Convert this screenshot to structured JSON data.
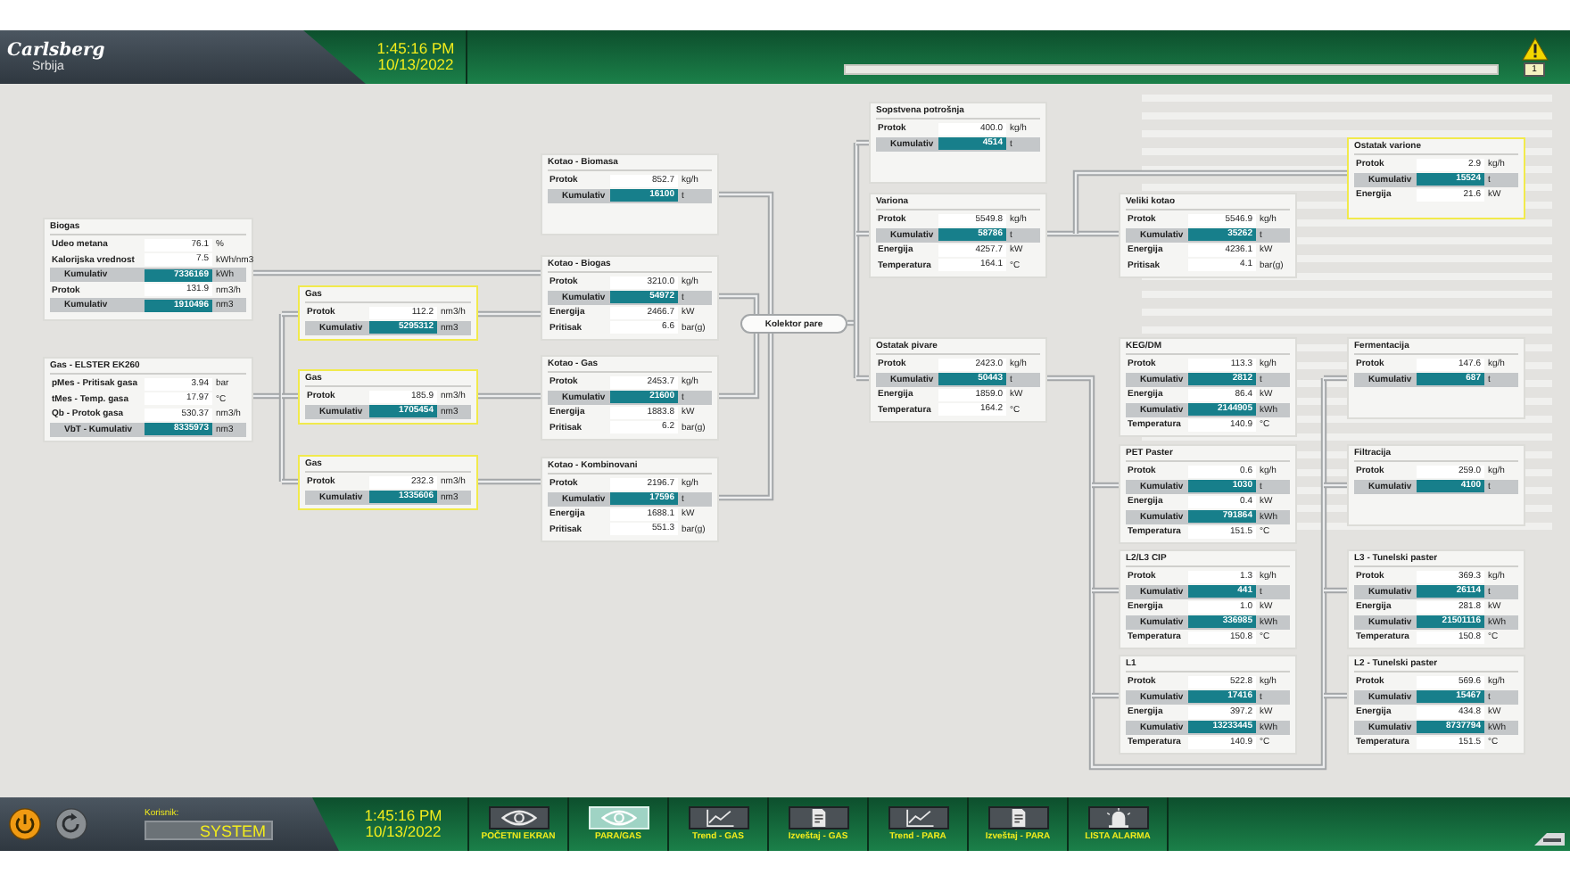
{
  "header": {
    "brand": "Carlsberg",
    "region": "Srbija",
    "time": "1:45:16 PM",
    "date": "10/13/2022",
    "alarm_count": "1"
  },
  "panels": [
    {
      "title": "Biogas",
      "highlighted": false,
      "rows": [
        {
          "kind": "value",
          "label": "Udeo metana",
          "value": "76.1",
          "unit": "%"
        },
        {
          "kind": "value",
          "label": "Kalorijska vrednost",
          "value": "7.5",
          "unit": "kWh/nm3"
        },
        {
          "kind": "total",
          "label": "Kumulativ",
          "value": "7336169",
          "unit": "kWh"
        },
        {
          "kind": "value",
          "label": "Protok",
          "value": "131.9",
          "unit": "nm3/h"
        },
        {
          "kind": "total",
          "label": "Kumulativ",
          "value": "1910496",
          "unit": "nm3"
        }
      ]
    },
    {
      "title": "Gas - ELSTER EK260",
      "highlighted": false,
      "rows": [
        {
          "kind": "value",
          "label": "pMes - Pritisak gasa",
          "value": "3.94",
          "unit": "bar"
        },
        {
          "kind": "value",
          "label": "tMes - Temp. gasa",
          "value": "17.97",
          "unit": "°C"
        },
        {
          "kind": "value",
          "label": "Qb - Protok gasa",
          "value": "530.37",
          "unit": "nm3/h"
        },
        {
          "kind": "total",
          "label": "VbT - Kumulativ",
          "value": "8335973",
          "unit": "nm3"
        }
      ]
    },
    {
      "title": "Gas",
      "highlighted": true,
      "rows": [
        {
          "kind": "value",
          "label": "Protok",
          "value": "112.2",
          "unit": "nm3/h"
        },
        {
          "kind": "total",
          "label": "Kumulativ",
          "value": "5295312",
          "unit": "nm3"
        }
      ]
    },
    {
      "title": "Gas",
      "highlighted": true,
      "rows": [
        {
          "kind": "value",
          "label": "Protok",
          "value": "185.9",
          "unit": "nm3/h"
        },
        {
          "kind": "total",
          "label": "Kumulativ",
          "value": "1705454",
          "unit": "nm3"
        }
      ]
    },
    {
      "title": "Gas",
      "highlighted": true,
      "rows": [
        {
          "kind": "value",
          "label": "Protok",
          "value": "232.3",
          "unit": "nm3/h"
        },
        {
          "kind": "total",
          "label": "Kumulativ",
          "value": "1335606",
          "unit": "nm3"
        }
      ]
    },
    {
      "title": "Kotao - Biomasa",
      "highlighted": false,
      "rows": [
        {
          "kind": "value",
          "label": "Protok",
          "value": "852.7",
          "unit": "kg/h"
        },
        {
          "kind": "total",
          "label": "Kumulativ",
          "value": "16100",
          "unit": "t"
        }
      ]
    },
    {
      "title": "Kotao - Biogas",
      "highlighted": false,
      "rows": [
        {
          "kind": "value",
          "label": "Protok",
          "value": "3210.0",
          "unit": "kg/h"
        },
        {
          "kind": "total",
          "label": "Kumulativ",
          "value": "54972",
          "unit": "t"
        },
        {
          "kind": "value",
          "label": "Energija",
          "value": "2466.7",
          "unit": "kW"
        },
        {
          "kind": "value",
          "label": "Pritisak",
          "value": "6.6",
          "unit": "bar(g)"
        }
      ]
    },
    {
      "title": "Kotao - Gas",
      "highlighted": false,
      "rows": [
        {
          "kind": "value",
          "label": "Protok",
          "value": "2453.7",
          "unit": "kg/h"
        },
        {
          "kind": "total",
          "label": "Kumulativ",
          "value": "21600",
          "unit": "t"
        },
        {
          "kind": "value",
          "label": "Energija",
          "value": "1883.8",
          "unit": "kW"
        },
        {
          "kind": "value",
          "label": "Pritisak",
          "value": "6.2",
          "unit": "bar(g)"
        }
      ]
    },
    {
      "title": "Kotao - Kombinovani",
      "highlighted": false,
      "rows": [
        {
          "kind": "value",
          "label": "Protok",
          "value": "2196.7",
          "unit": "kg/h"
        },
        {
          "kind": "total",
          "label": "Kumulativ",
          "value": "17596",
          "unit": "t"
        },
        {
          "kind": "value",
          "label": "Energija",
          "value": "1688.1",
          "unit": "kW"
        },
        {
          "kind": "value",
          "label": "Pritisak",
          "value": "551.3",
          "unit": "bar(g)"
        }
      ]
    },
    {
      "title": "Sopstvena potrošnja",
      "highlighted": false,
      "rows": [
        {
          "kind": "value",
          "label": "Protok",
          "value": "400.0",
          "unit": "kg/h"
        },
        {
          "kind": "total",
          "label": "Kumulativ",
          "value": "4514",
          "unit": "t"
        }
      ]
    },
    {
      "title": "Variona",
      "highlighted": false,
      "rows": [
        {
          "kind": "value",
          "label": "Protok",
          "value": "5549.8",
          "unit": "kg/h"
        },
        {
          "kind": "total",
          "label": "Kumulativ",
          "value": "58786",
          "unit": "t"
        },
        {
          "kind": "value",
          "label": "Energija",
          "value": "4257.7",
          "unit": "kW"
        },
        {
          "kind": "value",
          "label": "Temperatura",
          "value": "164.1",
          "unit": "°C"
        }
      ]
    },
    {
      "title": "Ostatak pivare",
      "highlighted": false,
      "rows": [
        {
          "kind": "value",
          "label": "Protok",
          "value": "2423.0",
          "unit": "kg/h"
        },
        {
          "kind": "total",
          "label": "Kumulativ",
          "value": "50443",
          "unit": "t"
        },
        {
          "kind": "value",
          "label": "Energija",
          "value": "1859.0",
          "unit": "kW"
        },
        {
          "kind": "value",
          "label": "Temperatura",
          "value": "164.2",
          "unit": "°C"
        }
      ]
    },
    {
      "title": "Veliki kotao",
      "highlighted": false,
      "rows": [
        {
          "kind": "value",
          "label": "Protok",
          "value": "5546.9",
          "unit": "kg/h"
        },
        {
          "kind": "total",
          "label": "Kumulativ",
          "value": "35262",
          "unit": "t"
        },
        {
          "kind": "value",
          "label": "Energija",
          "value": "4236.1",
          "unit": "kW"
        },
        {
          "kind": "value",
          "label": "Pritisak",
          "value": "4.1",
          "unit": "bar(g)"
        }
      ]
    },
    {
      "title": "Ostatak varione",
      "highlighted": true,
      "rows": [
        {
          "kind": "value",
          "label": "Protok",
          "value": "2.9",
          "unit": "kg/h"
        },
        {
          "kind": "total",
          "label": "Kumulativ",
          "value": "15524",
          "unit": "t"
        },
        {
          "kind": "value",
          "label": "Energija",
          "value": "21.6",
          "unit": "kW"
        }
      ]
    },
    {
      "title": "KEG/DM",
      "highlighted": false,
      "rows": [
        {
          "kind": "value",
          "label": "Protok",
          "value": "113.3",
          "unit": "kg/h"
        },
        {
          "kind": "total",
          "label": "Kumulativ",
          "value": "2812",
          "unit": "t"
        },
        {
          "kind": "value",
          "label": "Energija",
          "value": "86.4",
          "unit": "kW"
        },
        {
          "kind": "total",
          "label": "Kumulativ",
          "value": "2144905",
          "unit": "kWh"
        },
        {
          "kind": "value",
          "label": "Temperatura",
          "value": "140.9",
          "unit": "°C"
        }
      ]
    },
    {
      "title": "PET Paster",
      "highlighted": false,
      "rows": [
        {
          "kind": "value",
          "label": "Protok",
          "value": "0.6",
          "unit": "kg/h"
        },
        {
          "kind": "total",
          "label": "Kumulativ",
          "value": "1030",
          "unit": "t"
        },
        {
          "kind": "value",
          "label": "Energija",
          "value": "0.4",
          "unit": "kW"
        },
        {
          "kind": "total",
          "label": "Kumulativ",
          "value": "791864",
          "unit": "kWh"
        },
        {
          "kind": "value",
          "label": "Temperatura",
          "value": "151.5",
          "unit": "°C"
        }
      ]
    },
    {
      "title": "L2/L3 CIP",
      "highlighted": false,
      "rows": [
        {
          "kind": "value",
          "label": "Protok",
          "value": "1.3",
          "unit": "kg/h"
        },
        {
          "kind": "total",
          "label": "Kumulativ",
          "value": "441",
          "unit": "t"
        },
        {
          "kind": "value",
          "label": "Energija",
          "value": "1.0",
          "unit": "kW"
        },
        {
          "kind": "total",
          "label": "Kumulativ",
          "value": "336985",
          "unit": "kWh"
        },
        {
          "kind": "value",
          "label": "Temperatura",
          "value": "150.8",
          "unit": "°C"
        }
      ]
    },
    {
      "title": "L1",
      "highlighted": false,
      "rows": [
        {
          "kind": "value",
          "label": "Protok",
          "value": "522.8",
          "unit": "kg/h"
        },
        {
          "kind": "total",
          "label": "Kumulativ",
          "value": "17416",
          "unit": "t"
        },
        {
          "kind": "value",
          "label": "Energija",
          "value": "397.2",
          "unit": "kW"
        },
        {
          "kind": "total",
          "label": "Kumulativ",
          "value": "13233445",
          "unit": "kWh"
        },
        {
          "kind": "value",
          "label": "Temperatura",
          "value": "140.9",
          "unit": "°C"
        }
      ]
    },
    {
      "title": "Fermentacija",
      "highlighted": false,
      "rows": [
        {
          "kind": "value",
          "label": "Protok",
          "value": "147.6",
          "unit": "kg/h"
        },
        {
          "kind": "total",
          "label": "Kumulativ",
          "value": "687",
          "unit": "t"
        }
      ]
    },
    {
      "title": "Filtracija",
      "highlighted": false,
      "rows": [
        {
          "kind": "value",
          "label": "Protok",
          "value": "259.0",
          "unit": "kg/h"
        },
        {
          "kind": "total",
          "label": "Kumulativ",
          "value": "4100",
          "unit": "t"
        }
      ]
    },
    {
      "title": "L3 - Tunelski paster",
      "highlighted": false,
      "rows": [
        {
          "kind": "value",
          "label": "Protok",
          "value": "369.3",
          "unit": "kg/h"
        },
        {
          "kind": "total",
          "label": "Kumulativ",
          "value": "26114",
          "unit": "t"
        },
        {
          "kind": "value",
          "label": "Energija",
          "value": "281.8",
          "unit": "kW"
        },
        {
          "kind": "total",
          "label": "Kumulativ",
          "value": "21501116",
          "unit": "kWh"
        },
        {
          "kind": "value",
          "label": "Temperatura",
          "value": "150.8",
          "unit": "°C"
        }
      ]
    },
    {
      "title": "L2 - Tunelski paster",
      "highlighted": false,
      "rows": [
        {
          "kind": "value",
          "label": "Protok",
          "value": "569.6",
          "unit": "kg/h"
        },
        {
          "kind": "total",
          "label": "Kumulativ",
          "value": "15467",
          "unit": "t"
        },
        {
          "kind": "value",
          "label": "Energija",
          "value": "434.8",
          "unit": "kW"
        },
        {
          "kind": "total",
          "label": "Kumulativ",
          "value": "8737794",
          "unit": "kWh"
        },
        {
          "kind": "value",
          "label": "Temperatura",
          "value": "151.5",
          "unit": "°C"
        }
      ]
    }
  ],
  "collector": {
    "label": "Kolektor pare"
  },
  "footer": {
    "user_label": "Korisnik:",
    "user": "SYSTEM",
    "time": "1:45:16 PM",
    "date": "10/13/2022",
    "nav": [
      {
        "label": "POČETNI EKRAN",
        "kind": "view",
        "selected": false
      },
      {
        "label": "PARA/GAS",
        "kind": "view",
        "selected": true
      },
      {
        "label": "Trend - GAS",
        "kind": "trend",
        "selected": false
      },
      {
        "label": "Izveštaj - GAS",
        "kind": "report",
        "selected": false
      },
      {
        "label": "Trend - PARA",
        "kind": "trend",
        "selected": false
      },
      {
        "label": "Izveštaj - PARA",
        "kind": "report",
        "selected": false
      },
      {
        "label": "LISTA ALARMA",
        "kind": "alarm",
        "selected": false
      }
    ]
  }
}
